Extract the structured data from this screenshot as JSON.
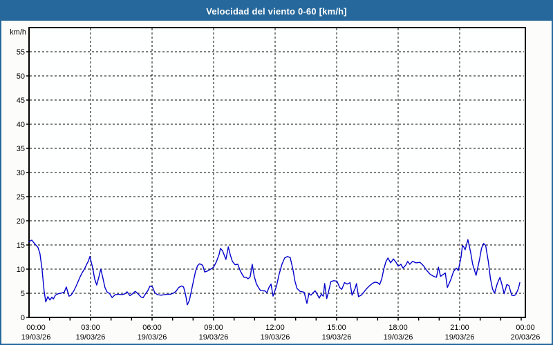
{
  "window": {
    "title": "Velocidad del viento 0-60 [km/h]"
  },
  "colors": {
    "title_bar_bg": "#26689b",
    "title_text": "#ffffff",
    "window_border": "#26689b",
    "page_bg": "#fcfdfa",
    "plot_bg": "#feffff",
    "axis": "#000000",
    "grid": "#000000",
    "label": "#000000",
    "line": "#0000cc"
  },
  "chart_data": {
    "type": "line",
    "title": "Velocidad del viento 0-60 [km/h]",
    "xlabel": "",
    "ylabel": "km/h",
    "ylim": [
      0,
      60
    ],
    "ytick_step": 5,
    "ytick_labels": [
      "0",
      "5",
      "10",
      "15",
      "20",
      "25",
      "30",
      "35",
      "40",
      "45",
      "50",
      "55"
    ],
    "grid": "dashed",
    "legend_position": "none",
    "x_total_minutes": 1440,
    "x_minor_tick_every_hours": 1,
    "x_major_ticks": [
      {
        "hour": 0,
        "time": "00:00",
        "date": "19/03/26"
      },
      {
        "hour": 3,
        "time": "03:00",
        "date": "19/03/26"
      },
      {
        "hour": 6,
        "time": "06:00",
        "date": "19/03/26"
      },
      {
        "hour": 9,
        "time": "09:00",
        "date": "19/03/26"
      },
      {
        "hour": 12,
        "time": "12:00",
        "date": "19/03/26"
      },
      {
        "hour": 15,
        "time": "15:00",
        "date": "19/03/26"
      },
      {
        "hour": 18,
        "time": "18:00",
        "date": "19/03/26"
      },
      {
        "hour": 21,
        "time": "21:00",
        "date": "19/03/26"
      },
      {
        "hour": 24,
        "time": "00:00",
        "date": "20/03/26"
      }
    ],
    "series": [
      {
        "name": "Velocidad del viento [km/h]",
        "x_unit": "minutes_from_first_00:00",
        "y_unit": "km/h",
        "points": [
          [
            0,
            15.7
          ],
          [
            8,
            16.0
          ],
          [
            16,
            15.3
          ],
          [
            26,
            14.5
          ],
          [
            32,
            13.2
          ],
          [
            38,
            10.0
          ],
          [
            44,
            5.5
          ],
          [
            49,
            3.2
          ],
          [
            55,
            4.3
          ],
          [
            61,
            3.6
          ],
          [
            67,
            4.2
          ],
          [
            71,
            3.8
          ],
          [
            77,
            4.6
          ],
          [
            85,
            4.9
          ],
          [
            93,
            5.0
          ],
          [
            103,
            5.2
          ],
          [
            109,
            6.3
          ],
          [
            117,
            4.4
          ],
          [
            123,
            4.6
          ],
          [
            131,
            5.5
          ],
          [
            138,
            6.5
          ],
          [
            144,
            7.5
          ],
          [
            150,
            8.5
          ],
          [
            156,
            9.3
          ],
          [
            162,
            10.0
          ],
          [
            168,
            10.9
          ],
          [
            174,
            11.7
          ],
          [
            178,
            12.6
          ],
          [
            186,
            10.3
          ],
          [
            192,
            8.0
          ],
          [
            198,
            6.7
          ],
          [
            204,
            8.3
          ],
          [
            210,
            10.0
          ],
          [
            216,
            8.2
          ],
          [
            222,
            6.2
          ],
          [
            228,
            5.3
          ],
          [
            236,
            4.9
          ],
          [
            243,
            4.1
          ],
          [
            252,
            4.7
          ],
          [
            262,
            4.8
          ],
          [
            272,
            4.7
          ],
          [
            281,
            4.9
          ],
          [
            287,
            5.3
          ],
          [
            295,
            4.5
          ],
          [
            303,
            4.9
          ],
          [
            311,
            5.4
          ],
          [
            320,
            4.8
          ],
          [
            328,
            4.2
          ],
          [
            334,
            4.1
          ],
          [
            341,
            4.9
          ],
          [
            348,
            5.6
          ],
          [
            354,
            6.5
          ],
          [
            361,
            6.3
          ],
          [
            368,
            5.1
          ],
          [
            376,
            4.7
          ],
          [
            386,
            4.6
          ],
          [
            396,
            4.7
          ],
          [
            406,
            4.8
          ],
          [
            414,
            4.8
          ],
          [
            422,
            5.0
          ],
          [
            430,
            5.4
          ],
          [
            438,
            6.2
          ],
          [
            446,
            6.5
          ],
          [
            452,
            6.3
          ],
          [
            456,
            5.3
          ],
          [
            460,
            4.0
          ],
          [
            463,
            2.6
          ],
          [
            469,
            3.5
          ],
          [
            475,
            5.5
          ],
          [
            481,
            7.5
          ],
          [
            487,
            9.5
          ],
          [
            493,
            10.7
          ],
          [
            499,
            11.1
          ],
          [
            508,
            10.8
          ],
          [
            514,
            9.4
          ],
          [
            522,
            9.6
          ],
          [
            532,
            10.0
          ],
          [
            540,
            10.4
          ],
          [
            548,
            11.5
          ],
          [
            556,
            13.0
          ],
          [
            560,
            14.3
          ],
          [
            566,
            13.8
          ],
          [
            576,
            12.0
          ],
          [
            583,
            14.6
          ],
          [
            589,
            12.9
          ],
          [
            595,
            11.6
          ],
          [
            603,
            10.9
          ],
          [
            611,
            11.0
          ],
          [
            617,
            9.8
          ],
          [
            623,
            9.0
          ],
          [
            629,
            8.3
          ],
          [
            635,
            8.3
          ],
          [
            641,
            8.0
          ],
          [
            647,
            8.4
          ],
          [
            653,
            11.0
          ],
          [
            659,
            8.5
          ],
          [
            665,
            7.0
          ],
          [
            671,
            6.2
          ],
          [
            677,
            5.6
          ],
          [
            684,
            5.5
          ],
          [
            690,
            5.5
          ],
          [
            696,
            5.1
          ],
          [
            702,
            6.2
          ],
          [
            708,
            6.9
          ],
          [
            714,
            4.4
          ],
          [
            724,
            6.5
          ],
          [
            732,
            9.0
          ],
          [
            740,
            11.0
          ],
          [
            748,
            12.3
          ],
          [
            756,
            12.6
          ],
          [
            764,
            12.4
          ],
          [
            772,
            10.0
          ],
          [
            778,
            7.5
          ],
          [
            784,
            6.0
          ],
          [
            793,
            5.4
          ],
          [
            805,
            5.2
          ],
          [
            813,
            2.9
          ],
          [
            819,
            4.9
          ],
          [
            825,
            4.6
          ],
          [
            831,
            5.1
          ],
          [
            837,
            5.5
          ],
          [
            843,
            4.8
          ],
          [
            849,
            4.0
          ],
          [
            855,
            4.8
          ],
          [
            861,
            4.4
          ],
          [
            865,
            7.0
          ],
          [
            871,
            3.9
          ],
          [
            877,
            5.5
          ],
          [
            883,
            7.4
          ],
          [
            891,
            7.6
          ],
          [
            901,
            7.5
          ],
          [
            909,
            6.2
          ],
          [
            915,
            5.8
          ],
          [
            923,
            7.2
          ],
          [
            931,
            6.9
          ],
          [
            939,
            7.2
          ],
          [
            945,
            4.6
          ],
          [
            954,
            6.0
          ],
          [
            958,
            7.0
          ],
          [
            964,
            4.3
          ],
          [
            972,
            4.6
          ],
          [
            978,
            5.1
          ],
          [
            986,
            5.8
          ],
          [
            994,
            6.4
          ],
          [
            1004,
            7.0
          ],
          [
            1012,
            7.3
          ],
          [
            1020,
            7.2
          ],
          [
            1026,
            6.8
          ],
          [
            1032,
            8.0
          ],
          [
            1038,
            10.0
          ],
          [
            1044,
            11.5
          ],
          [
            1050,
            12.3
          ],
          [
            1058,
            11.3
          ],
          [
            1066,
            12.1
          ],
          [
            1074,
            11.4
          ],
          [
            1080,
            10.6
          ],
          [
            1088,
            11.0
          ],
          [
            1094,
            10.2
          ],
          [
            1102,
            10.8
          ],
          [
            1108,
            11.6
          ],
          [
            1114,
            11.0
          ],
          [
            1122,
            11.6
          ],
          [
            1132,
            11.3
          ],
          [
            1144,
            11.4
          ],
          [
            1154,
            10.7
          ],
          [
            1164,
            9.7
          ],
          [
            1174,
            8.9
          ],
          [
            1184,
            8.5
          ],
          [
            1192,
            8.3
          ],
          [
            1198,
            10.4
          ],
          [
            1204,
            8.5
          ],
          [
            1212,
            8.9
          ],
          [
            1218,
            9.2
          ],
          [
            1224,
            6.2
          ],
          [
            1234,
            7.8
          ],
          [
            1242,
            9.5
          ],
          [
            1250,
            10.2
          ],
          [
            1256,
            9.7
          ],
          [
            1264,
            12.5
          ],
          [
            1268,
            14.9
          ],
          [
            1272,
            14.6
          ],
          [
            1276,
            14.0
          ],
          [
            1284,
            16.1
          ],
          [
            1292,
            13.5
          ],
          [
            1298,
            11.0
          ],
          [
            1308,
            8.7
          ],
          [
            1318,
            12.0
          ],
          [
            1324,
            14.3
          ],
          [
            1330,
            15.3
          ],
          [
            1336,
            14.9
          ],
          [
            1344,
            11.5
          ],
          [
            1350,
            8.0
          ],
          [
            1356,
            5.9
          ],
          [
            1362,
            5.0
          ],
          [
            1370,
            7.0
          ],
          [
            1378,
            8.3
          ],
          [
            1384,
            6.7
          ],
          [
            1390,
            4.9
          ],
          [
            1398,
            6.8
          ],
          [
            1404,
            6.6
          ],
          [
            1412,
            4.6
          ],
          [
            1418,
            4.5
          ],
          [
            1424,
            4.7
          ],
          [
            1432,
            6.0
          ],
          [
            1436,
            7.2
          ]
        ]
      }
    ]
  }
}
